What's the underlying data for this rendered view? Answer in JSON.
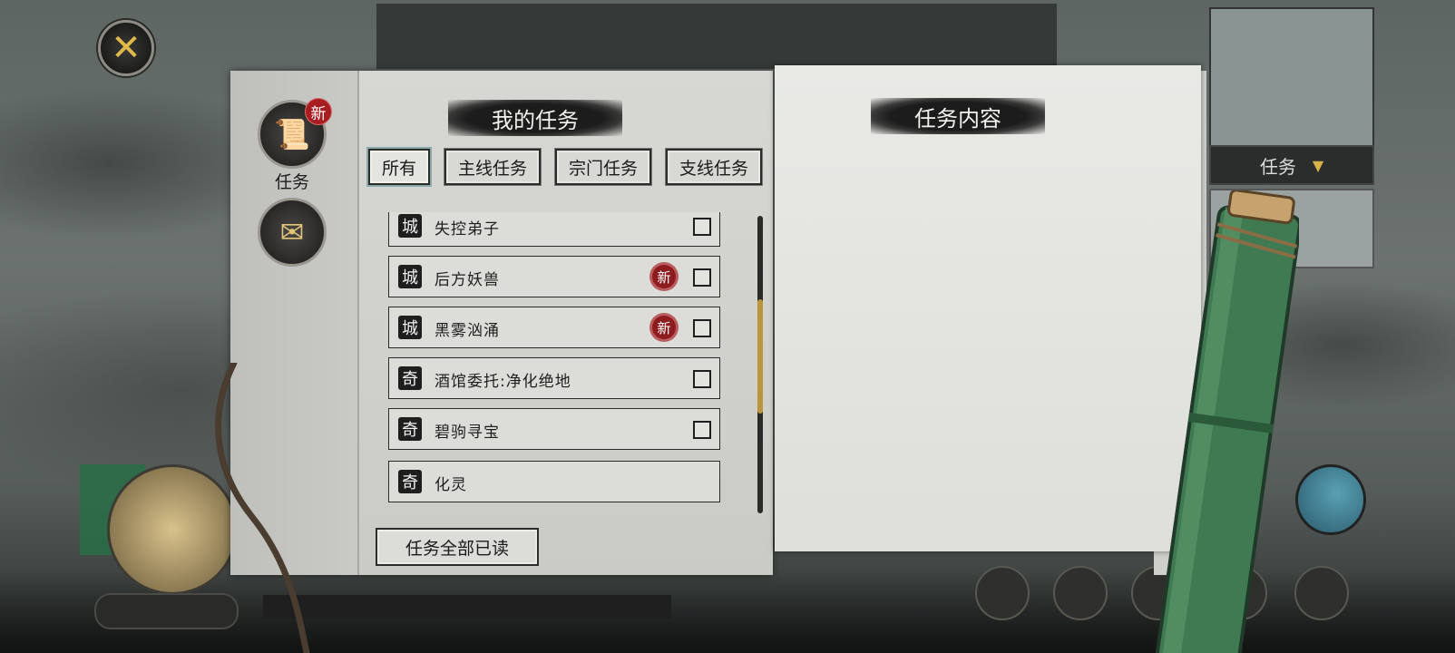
{
  "nav": {
    "tasks_label": "任务",
    "tasks_badge": "新"
  },
  "panel_left": {
    "title": "我的任务"
  },
  "filters": [
    {
      "label": "所有",
      "active": true
    },
    {
      "label": "主线任务",
      "active": false
    },
    {
      "label": "宗门任务",
      "active": false
    },
    {
      "label": "支线任务",
      "active": false
    }
  ],
  "quests": [
    {
      "category": "城",
      "name": "失控弟子",
      "new": false,
      "checkbox": true
    },
    {
      "category": "城",
      "name": "后方妖兽",
      "new": true,
      "new_label": "新",
      "checkbox": true
    },
    {
      "category": "城",
      "name": "黑雾汹涌",
      "new": true,
      "new_label": "新",
      "checkbox": true
    },
    {
      "category": "奇",
      "name": "酒馆委托:净化绝地",
      "new": false,
      "checkbox": true
    },
    {
      "category": "奇",
      "name": "碧驹寻宝",
      "new": false,
      "checkbox": true
    },
    {
      "category": "奇",
      "name": "化灵",
      "new": false,
      "checkbox": false
    }
  ],
  "read_all_button": "任务全部已读",
  "panel_right": {
    "title": "任务内容"
  },
  "background_hud": {
    "minimap_tab_label": "任务"
  },
  "colors": {
    "paper": "#d7d7d3",
    "ink": "#1c1c1c",
    "badge_red": "#a81d22",
    "scroll_thumb": "#b9953e",
    "bamboo_green": "#3f7a52"
  }
}
